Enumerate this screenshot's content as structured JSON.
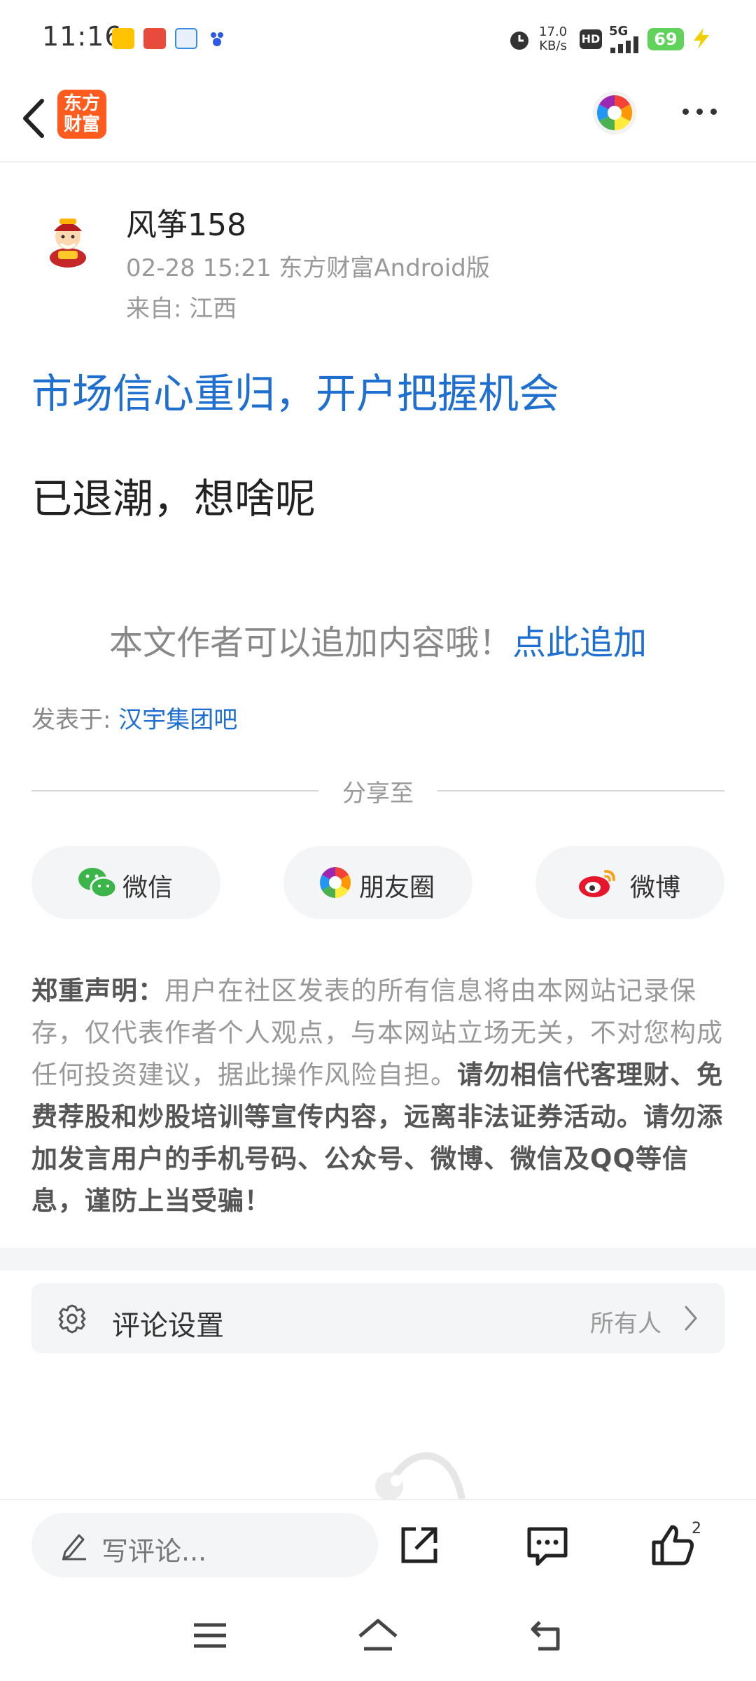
{
  "status": {
    "time": "11:16",
    "speed_value": "17.0",
    "speed_unit": "KB/s",
    "network": "5G",
    "hd": "HD",
    "battery": "69",
    "notif_icons": [
      "meituan-icon",
      "toutiao-icon",
      "chinamobile-icon",
      "baidu-icon"
    ]
  },
  "header": {
    "logo_line1": "东方",
    "logo_line2": "财富"
  },
  "post": {
    "author": "风筝158",
    "meta": "02-28 15:21 东方财富Android版",
    "from": "来自: 江西",
    "title": "市场信心重归，开户把握机会",
    "body": "已退潮，想啥呢",
    "append_text": "本文作者可以追加内容哦！",
    "append_link": "点此追加",
    "posted_in_label": "发表于: ",
    "posted_in_link": "汉宇集团吧"
  },
  "share": {
    "label": "分享至",
    "wechat": "微信",
    "moments": "朋友圈",
    "weibo": "微博"
  },
  "notice": {
    "heading": "郑重声明：",
    "normal": "用户在社区发表的所有信息将由本网站记录保存，仅代表作者个人观点，与本网站立场无关，不对您构成任何投资建议，据此操作风险自担。",
    "bold": "请勿相信代客理财、免费荐股和炒股培训等宣传内容，远离非法证券活动。请勿添加发言用户的手机号码、公众号、微博、微信及QQ等信息，谨防上当受骗！"
  },
  "comment_settings": {
    "label": "评论设置",
    "value": "所有人"
  },
  "bottom": {
    "write_placeholder": "写评论...",
    "like_count": "2"
  },
  "colors": {
    "accent": "#1f6fd0",
    "brand": "#ff5b1f",
    "battery": "#5fd35a"
  }
}
